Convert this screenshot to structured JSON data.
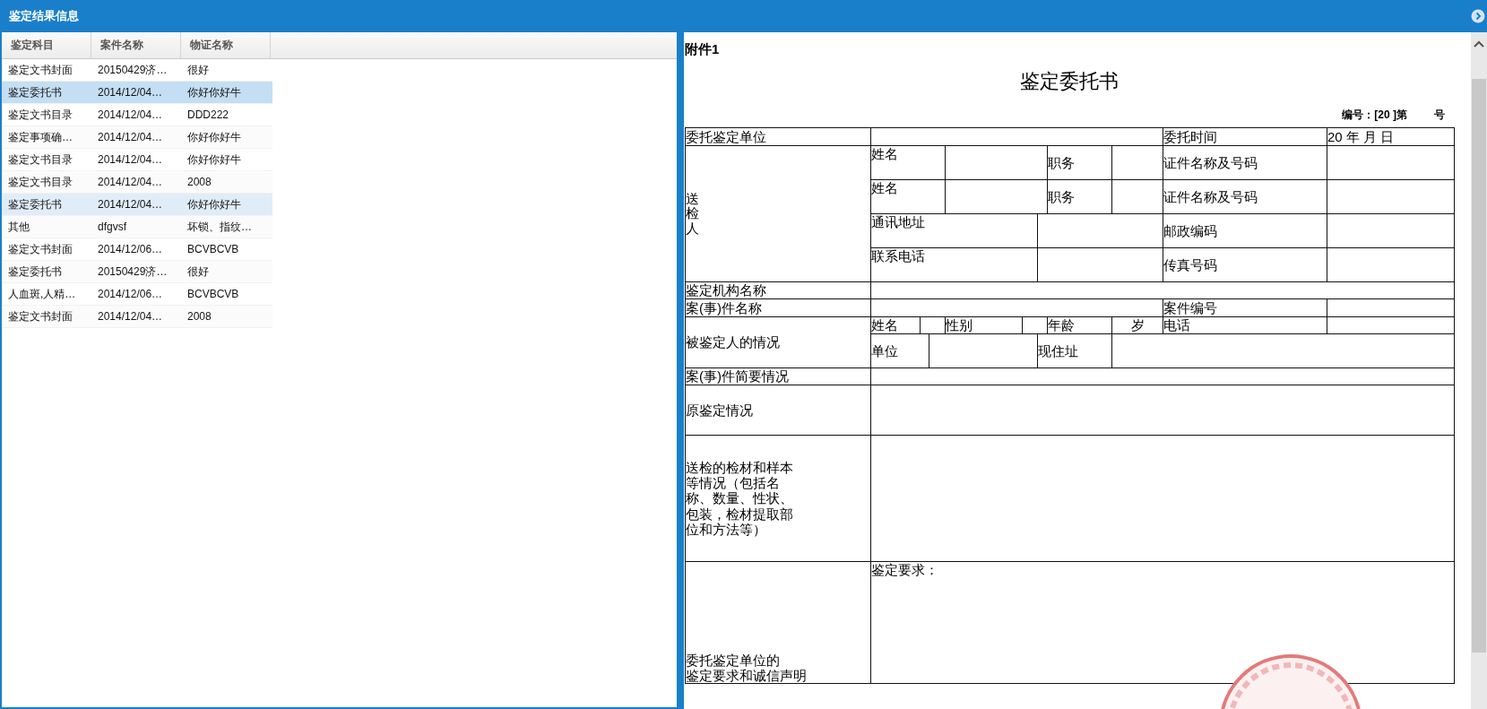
{
  "left_panel": {
    "title": "鉴定结果信息",
    "columns": [
      "鉴定科目",
      "案件名称",
      "物证名称"
    ],
    "rows": [
      {
        "cells": [
          "鉴定文书封面",
          "20150429济…",
          "很好"
        ],
        "selected": false,
        "hovered": false
      },
      {
        "cells": [
          "鉴定委托书",
          "2014/12/04…",
          "你好你好牛"
        ],
        "selected": true,
        "hovered": false
      },
      {
        "cells": [
          "鉴定文书目录",
          "2014/12/04…",
          "DDD222"
        ],
        "selected": false,
        "hovered": false
      },
      {
        "cells": [
          "鉴定事项确…",
          "2014/12/04…",
          "你好你好牛"
        ],
        "selected": false,
        "hovered": false
      },
      {
        "cells": [
          "鉴定文书目录",
          "2014/12/04…",
          "你好你好牛"
        ],
        "selected": false,
        "hovered": false
      },
      {
        "cells": [
          "鉴定文书目录",
          "2014/12/04…",
          "2008"
        ],
        "selected": false,
        "hovered": false
      },
      {
        "cells": [
          "鉴定委托书",
          "2014/12/04…",
          "你好你好牛"
        ],
        "selected": false,
        "hovered": true
      },
      {
        "cells": [
          "其他",
          "dfgvsf",
          "坏锁、指纹…"
        ],
        "selected": false,
        "hovered": false
      },
      {
        "cells": [
          "鉴定文书封面",
          "2014/12/06…",
          "BCVBCVB"
        ],
        "selected": false,
        "hovered": false
      },
      {
        "cells": [
          "鉴定委托书",
          "20150429济…",
          "很好"
        ],
        "selected": false,
        "hovered": false
      },
      {
        "cells": [
          "人血斑,人精…",
          "2014/12/06…",
          "BCVBCVB"
        ],
        "selected": false,
        "hovered": false
      },
      {
        "cells": [
          "鉴定文书封面",
          "2014/12/04…",
          "2008"
        ],
        "selected": false,
        "hovered": false
      }
    ]
  },
  "document": {
    "attachment": "附件1",
    "title": "鉴定委托书",
    "number_prefix": "编号：[20 ]第",
    "number_suffix": "号",
    "labels": [
      "委托鉴定单位",
      "委托时间",
      "20 年 月 日",
      "送检人",
      "姓名",
      "职务",
      "证件名称及号码",
      "姓名",
      "职务",
      "证件名称及号码",
      "通讯地址",
      "邮政编码",
      "联系电话",
      "传真号码",
      "鉴定机构名称",
      "案(事)件名称",
      "案件编号",
      "被鉴定人的情况",
      "姓名",
      "性别",
      "年龄",
      "岁",
      "电话",
      "单位",
      "现住址",
      "案(事)件简要情况",
      "原鉴定情况",
      "送检的检材和样本等情况（包括名称、数量、性状、包装，检材提取部位和方法等）",
      "委托鉴定单位的",
      "鉴定要求和诚信声明",
      "鉴定要求："
    ]
  }
}
